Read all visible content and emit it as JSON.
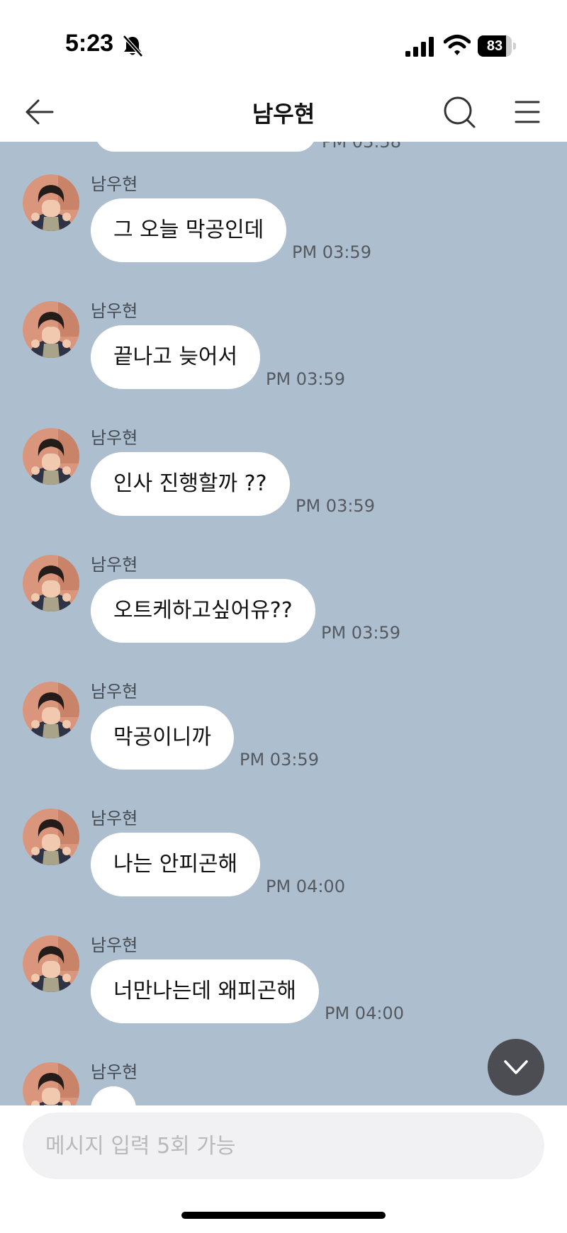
{
  "status_bar": {
    "time": "5:23",
    "battery": "83",
    "battery_level": 0.83
  },
  "header": {
    "title": "남우현"
  },
  "chat": {
    "partial_time": "PM 03:58",
    "messages": [
      {
        "sender": "남우현",
        "text": "그 오늘 막공인데",
        "time": "PM 03:59"
      },
      {
        "sender": "남우현",
        "text": "끝나고 늦어서",
        "time": "PM 03:59"
      },
      {
        "sender": "남우현",
        "text": "인사 진행할까 ??",
        "time": "PM 03:59"
      },
      {
        "sender": "남우현",
        "text": "오트케하고싶어유??",
        "time": "PM 03:59"
      },
      {
        "sender": "남우현",
        "text": "막공이니까",
        "time": "PM 03:59"
      },
      {
        "sender": "남우현",
        "text": "나는 안피곤해",
        "time": "PM 04:00"
      },
      {
        "sender": "남우현",
        "text": "너만나는데 왜피곤해",
        "time": "PM 04:00"
      },
      {
        "sender": "남우현",
        "text": "",
        "time": ""
      }
    ]
  },
  "input": {
    "placeholder": "메시지 입력 5회 가능"
  },
  "colors": {
    "chat_background": "#adbfcf",
    "bubble": "#ffffff",
    "scroll_button": "#4b4d52"
  }
}
